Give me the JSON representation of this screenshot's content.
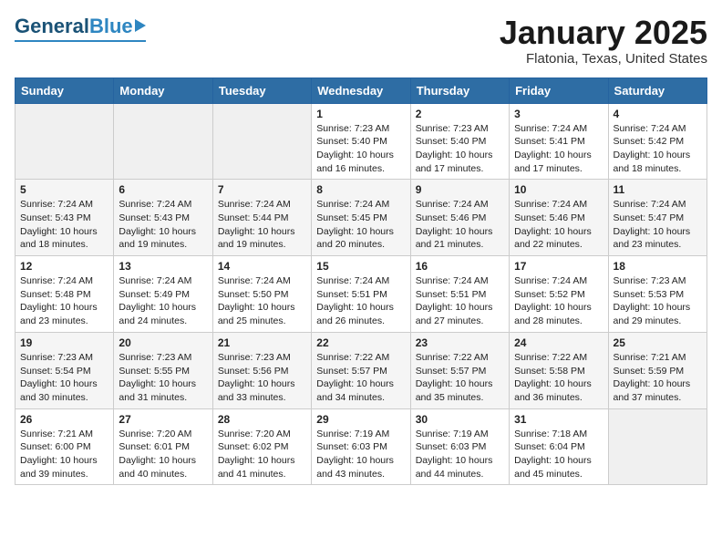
{
  "header": {
    "logo_general": "General",
    "logo_blue": "Blue",
    "month_title": "January 2025",
    "location": "Flatonia, Texas, United States"
  },
  "days_of_week": [
    "Sunday",
    "Monday",
    "Tuesday",
    "Wednesday",
    "Thursday",
    "Friday",
    "Saturday"
  ],
  "weeks": [
    [
      {
        "day": "",
        "content": ""
      },
      {
        "day": "",
        "content": ""
      },
      {
        "day": "",
        "content": ""
      },
      {
        "day": "1",
        "content": "Sunrise: 7:23 AM\nSunset: 5:40 PM\nDaylight: 10 hours and 16 minutes."
      },
      {
        "day": "2",
        "content": "Sunrise: 7:23 AM\nSunset: 5:40 PM\nDaylight: 10 hours and 17 minutes."
      },
      {
        "day": "3",
        "content": "Sunrise: 7:24 AM\nSunset: 5:41 PM\nDaylight: 10 hours and 17 minutes."
      },
      {
        "day": "4",
        "content": "Sunrise: 7:24 AM\nSunset: 5:42 PM\nDaylight: 10 hours and 18 minutes."
      }
    ],
    [
      {
        "day": "5",
        "content": "Sunrise: 7:24 AM\nSunset: 5:43 PM\nDaylight: 10 hours and 18 minutes."
      },
      {
        "day": "6",
        "content": "Sunrise: 7:24 AM\nSunset: 5:43 PM\nDaylight: 10 hours and 19 minutes."
      },
      {
        "day": "7",
        "content": "Sunrise: 7:24 AM\nSunset: 5:44 PM\nDaylight: 10 hours and 19 minutes."
      },
      {
        "day": "8",
        "content": "Sunrise: 7:24 AM\nSunset: 5:45 PM\nDaylight: 10 hours and 20 minutes."
      },
      {
        "day": "9",
        "content": "Sunrise: 7:24 AM\nSunset: 5:46 PM\nDaylight: 10 hours and 21 minutes."
      },
      {
        "day": "10",
        "content": "Sunrise: 7:24 AM\nSunset: 5:46 PM\nDaylight: 10 hours and 22 minutes."
      },
      {
        "day": "11",
        "content": "Sunrise: 7:24 AM\nSunset: 5:47 PM\nDaylight: 10 hours and 23 minutes."
      }
    ],
    [
      {
        "day": "12",
        "content": "Sunrise: 7:24 AM\nSunset: 5:48 PM\nDaylight: 10 hours and 23 minutes."
      },
      {
        "day": "13",
        "content": "Sunrise: 7:24 AM\nSunset: 5:49 PM\nDaylight: 10 hours and 24 minutes."
      },
      {
        "day": "14",
        "content": "Sunrise: 7:24 AM\nSunset: 5:50 PM\nDaylight: 10 hours and 25 minutes."
      },
      {
        "day": "15",
        "content": "Sunrise: 7:24 AM\nSunset: 5:51 PM\nDaylight: 10 hours and 26 minutes."
      },
      {
        "day": "16",
        "content": "Sunrise: 7:24 AM\nSunset: 5:51 PM\nDaylight: 10 hours and 27 minutes."
      },
      {
        "day": "17",
        "content": "Sunrise: 7:24 AM\nSunset: 5:52 PM\nDaylight: 10 hours and 28 minutes."
      },
      {
        "day": "18",
        "content": "Sunrise: 7:23 AM\nSunset: 5:53 PM\nDaylight: 10 hours and 29 minutes."
      }
    ],
    [
      {
        "day": "19",
        "content": "Sunrise: 7:23 AM\nSunset: 5:54 PM\nDaylight: 10 hours and 30 minutes."
      },
      {
        "day": "20",
        "content": "Sunrise: 7:23 AM\nSunset: 5:55 PM\nDaylight: 10 hours and 31 minutes."
      },
      {
        "day": "21",
        "content": "Sunrise: 7:23 AM\nSunset: 5:56 PM\nDaylight: 10 hours and 33 minutes."
      },
      {
        "day": "22",
        "content": "Sunrise: 7:22 AM\nSunset: 5:57 PM\nDaylight: 10 hours and 34 minutes."
      },
      {
        "day": "23",
        "content": "Sunrise: 7:22 AM\nSunset: 5:57 PM\nDaylight: 10 hours and 35 minutes."
      },
      {
        "day": "24",
        "content": "Sunrise: 7:22 AM\nSunset: 5:58 PM\nDaylight: 10 hours and 36 minutes."
      },
      {
        "day": "25",
        "content": "Sunrise: 7:21 AM\nSunset: 5:59 PM\nDaylight: 10 hours and 37 minutes."
      }
    ],
    [
      {
        "day": "26",
        "content": "Sunrise: 7:21 AM\nSunset: 6:00 PM\nDaylight: 10 hours and 39 minutes."
      },
      {
        "day": "27",
        "content": "Sunrise: 7:20 AM\nSunset: 6:01 PM\nDaylight: 10 hours and 40 minutes."
      },
      {
        "day": "28",
        "content": "Sunrise: 7:20 AM\nSunset: 6:02 PM\nDaylight: 10 hours and 41 minutes."
      },
      {
        "day": "29",
        "content": "Sunrise: 7:19 AM\nSunset: 6:03 PM\nDaylight: 10 hours and 43 minutes."
      },
      {
        "day": "30",
        "content": "Sunrise: 7:19 AM\nSunset: 6:03 PM\nDaylight: 10 hours and 44 minutes."
      },
      {
        "day": "31",
        "content": "Sunrise: 7:18 AM\nSunset: 6:04 PM\nDaylight: 10 hours and 45 minutes."
      },
      {
        "day": "",
        "content": ""
      }
    ]
  ]
}
